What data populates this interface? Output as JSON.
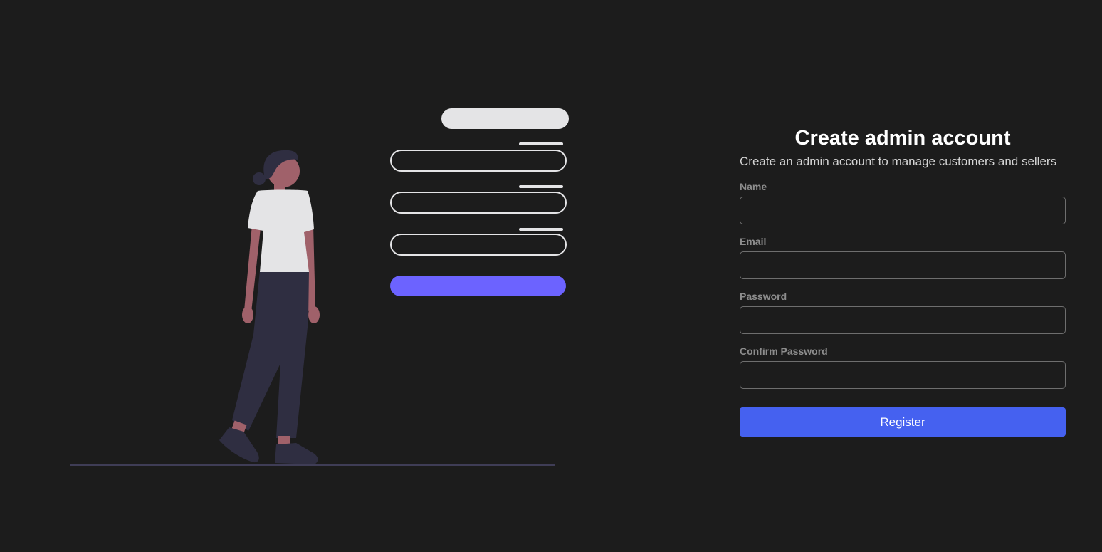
{
  "form": {
    "title": "Create admin account",
    "subtitle": "Create an admin account to manage customers and sellers",
    "fields": [
      {
        "label": "Name",
        "value": "",
        "placeholder": "",
        "type": "text"
      },
      {
        "label": "Email",
        "value": "",
        "placeholder": "",
        "type": "email"
      },
      {
        "label": "Password",
        "value": "",
        "placeholder": "",
        "type": "password"
      },
      {
        "label": "Confirm Password",
        "value": "",
        "placeholder": "",
        "type": "password"
      }
    ],
    "submit_label": "Register"
  },
  "colors": {
    "background": "#1c1c1c",
    "accent": "#4561f0",
    "illustration_accent": "#6c63ff"
  }
}
